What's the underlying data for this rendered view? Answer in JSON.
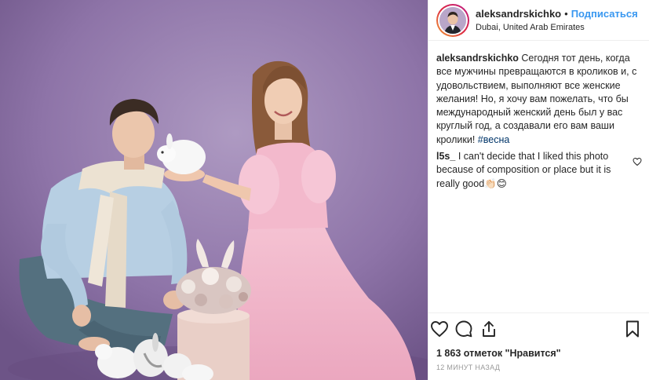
{
  "post": {
    "image_alt": "photo",
    "header": {
      "username": "aleksandrskichko",
      "separator": "•",
      "follow_label": "Подписаться",
      "location": "Dubai, United Arab Emirates"
    },
    "caption": {
      "username": "aleksandrskichko",
      "text": "Сегодня тот день, когда все мужчины превращаются в кроликов и, с удовольствием, выполняют все женские желания! Но, я хочу вам пожелать, что бы международный женский день был у вас круглый год, а создавали его вам ваши кролики!",
      "hashtag": "#весна"
    },
    "comments": [
      {
        "username": "l5s_",
        "text": "I can't decide that I liked this photo because of composition or place but it is really good👏🏻😊"
      }
    ],
    "likes_text": "1 863 отметок \"Нравится\"",
    "timestamp": "12 минут назад",
    "icons": {
      "like": "heart-icon",
      "comment": "speech-bubble-icon",
      "share": "share-arrow-icon",
      "save": "bookmark-icon"
    },
    "colors": {
      "follow": "#3897f0",
      "hashtag": "#003569",
      "background_photo": "#8f76a8",
      "dress": "#f2b6c9"
    }
  }
}
